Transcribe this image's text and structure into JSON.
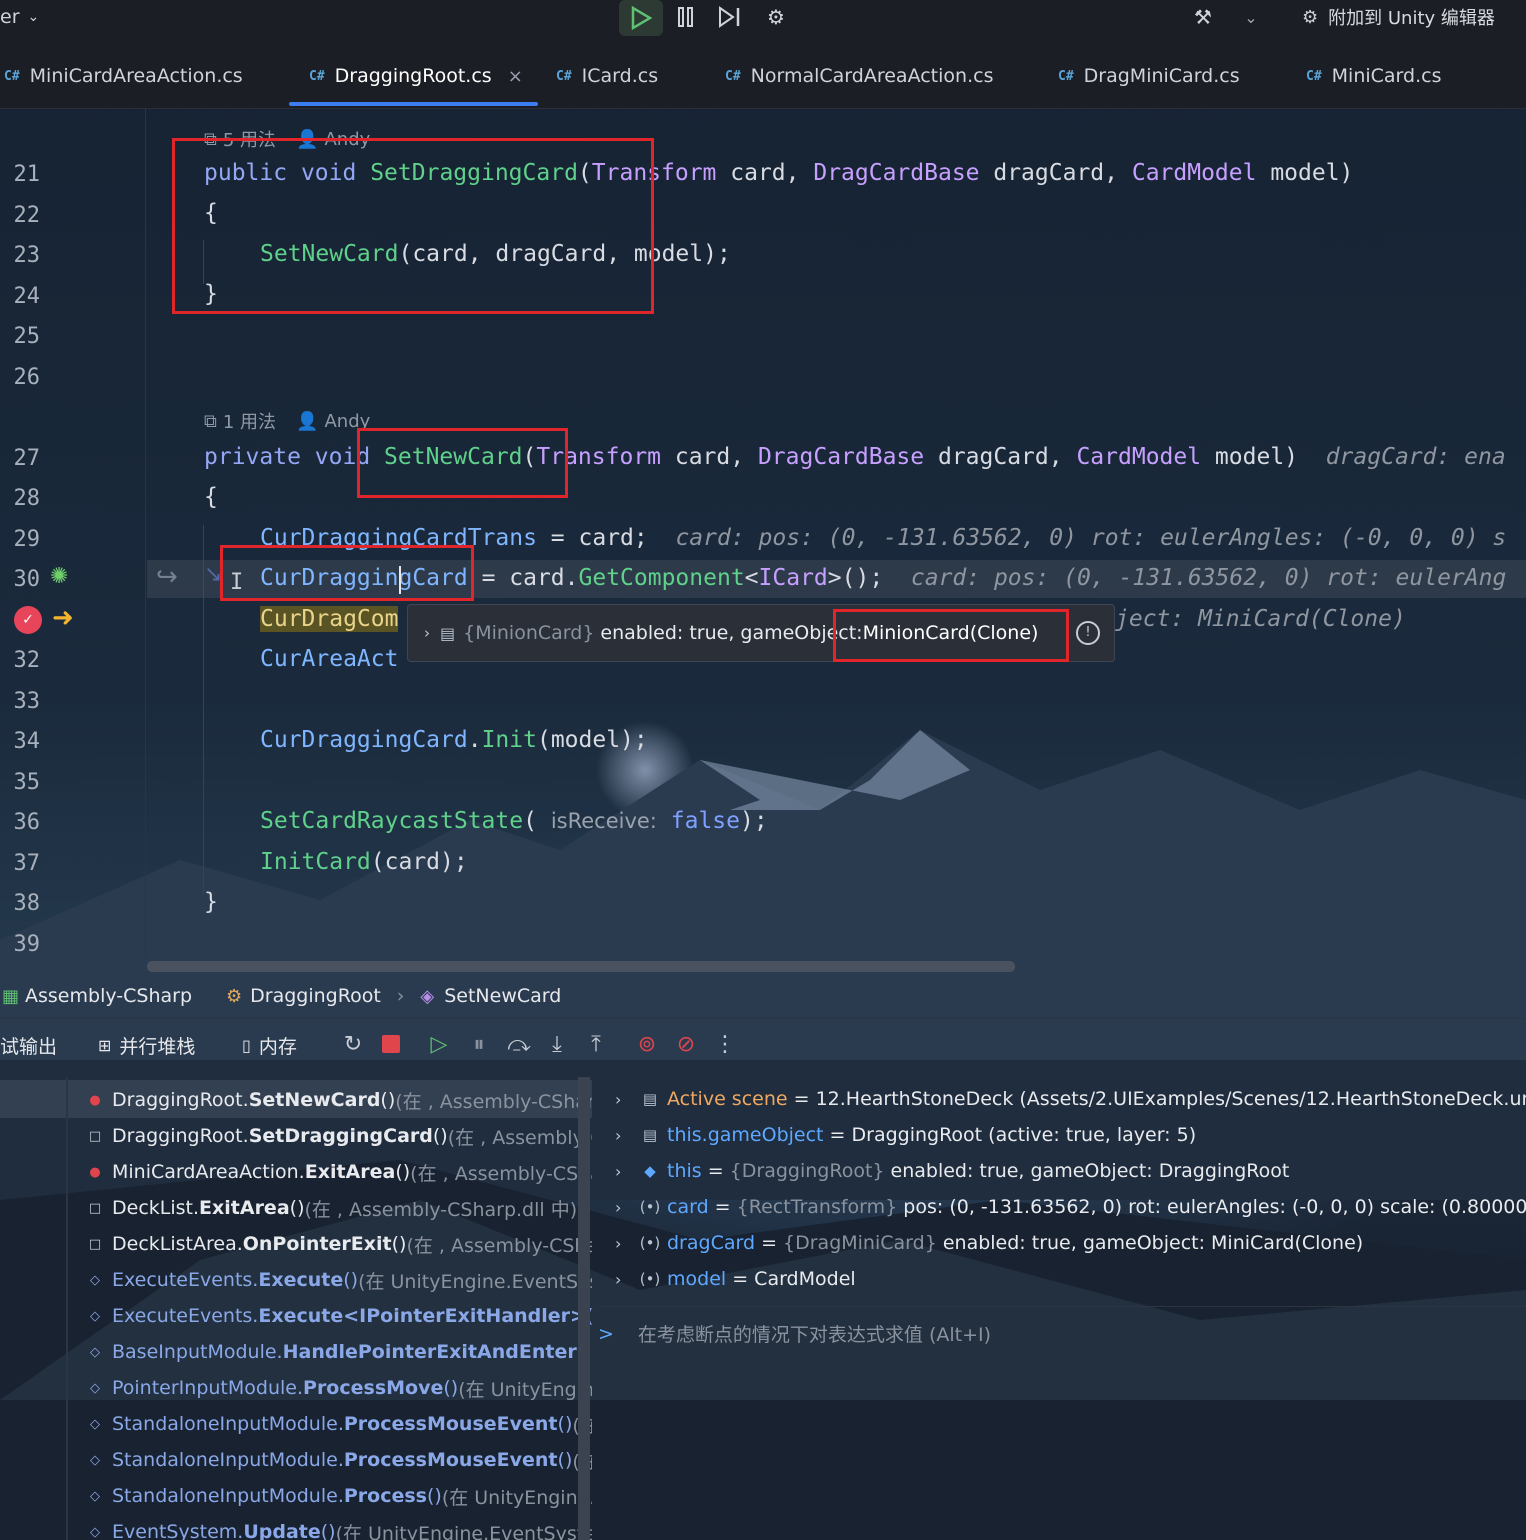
{
  "toolbar": {
    "left_label": "er",
    "attach_label": "附加到 Unity 编辑器"
  },
  "tabs": [
    {
      "label": "MiniCardAreaAction.cs"
    },
    {
      "label": "DraggingRoot.cs",
      "active": true
    },
    {
      "label": "ICard.cs"
    },
    {
      "label": "NormalCardAreaAction.cs"
    },
    {
      "label": "DragMiniCard.cs"
    },
    {
      "label": "MiniCard.cs"
    }
  ],
  "tab_prefix": "C#",
  "editor": {
    "line_numbers": [
      "21",
      "22",
      "23",
      "24",
      "25",
      "26",
      "27",
      "28",
      "29",
      "30",
      "31",
      "32",
      "33",
      "34",
      "35",
      "36",
      "37",
      "38",
      "39"
    ],
    "meta1": {
      "usages": "5 用法",
      "author": "Andy"
    },
    "meta2": {
      "usages": "1 用法",
      "author": "Andy"
    },
    "hint_param": "isReceive:",
    "inlay29": "card: pos: (0, -131.63562, 0) rot: eulerAngles: (-0, 0, 0) s",
    "inlay30": "card: pos: (0, -131.63562, 0) rot: eulerAng",
    "inlay27": "dragCard: ena",
    "inlay31": "ject: MiniCard(Clone)"
  },
  "tooltip": {
    "type": "{MinionCard}",
    "text": "enabled: true, gameObject: ",
    "value": "MinionCard(Clone)"
  },
  "breadcrumb": [
    "Assembly-CSharp",
    "DraggingRoot",
    "SetNewCard"
  ],
  "debug_tabs": {
    "output": "试输出",
    "parallel": "并行堆栈",
    "memory": "内存"
  },
  "frames": [
    {
      "marker": "dot",
      "cls": "DraggingRoot.",
      "method": "SetNewCard",
      "args": "()",
      "loc": " (在 , Assembly-CSharp"
    },
    {
      "marker": "square",
      "cls": "DraggingRoot.",
      "method": "SetDraggingCard",
      "args": "()",
      "loc": " (在 , Assembly-C"
    },
    {
      "marker": "dot",
      "cls": "MiniCardAreaAction.",
      "method": "ExitArea",
      "args": "()",
      "loc": " (在 , Assembly-CSha"
    },
    {
      "marker": "square",
      "cls": "DeckList.",
      "method": "ExitArea",
      "args": "()",
      "loc": " (在 , Assembly-CSharp.dll 中)"
    },
    {
      "marker": "square",
      "cls": "DeckListArea.",
      "method": "OnPointerExit",
      "args": "()",
      "loc": " (在 , Assembly-CShar"
    },
    {
      "marker": "diamond",
      "cls": "ExecuteEvents.",
      "method": "Execute",
      "args": "()",
      "loc": " (在 UnityEngine.EventSyst"
    },
    {
      "marker": "diamond",
      "cls": "ExecuteEvents.",
      "method": "Execute<IPointerExitHandler>",
      "args": "()",
      "loc": " (在"
    },
    {
      "marker": "diamond",
      "cls": "BaseInputModule.",
      "method": "HandlePointerExitAndEnter",
      "args": "()",
      "loc": " (在"
    },
    {
      "marker": "diamond",
      "cls": "PointerInputModule.",
      "method": "ProcessMove",
      "args": "()",
      "loc": " (在 UnityEngine"
    },
    {
      "marker": "diamond",
      "cls": "StandaloneInputModule.",
      "method": "ProcessMouseEvent",
      "args": "()",
      "loc": " (在 U"
    },
    {
      "marker": "diamond",
      "cls": "StandaloneInputModule.",
      "method": "ProcessMouseEvent",
      "args": "()",
      "loc": " (在 U"
    },
    {
      "marker": "diamond",
      "cls": "StandaloneInputModule.",
      "method": "Process",
      "args": "()",
      "loc": " (在 UnityEngine.E"
    },
    {
      "marker": "diamond",
      "cls": "EventSystem.",
      "method": "Update",
      "args": "()",
      "loc": " (在 UnityEngine.EventSystem"
    }
  ],
  "variables": [
    {
      "icon": "scene-icon",
      "name": "Active scene",
      "eq": " = ",
      "type": "",
      "value": "12.HearthStoneDeck (Assets/2.UIExamples/Scenes/12.HearthStoneDeck.unity)"
    },
    {
      "icon": "object-icon",
      "name": "this.gameObject",
      "eq": " = ",
      "type": "",
      "value": "DraggingRoot (active: true, layer: 5)"
    },
    {
      "icon": "this-icon",
      "name": "this",
      "eq": " = ",
      "type": "{DraggingRoot}",
      "value": " enabled: true, gameObject: DraggingRoot"
    },
    {
      "icon": "param-icon",
      "name": "card",
      "eq": " = ",
      "type": "{RectTransform}",
      "value": " pos: (0, -131.63562, 0) rot: eulerAngles: (-0, 0, 0) scale: (0.800000012"
    },
    {
      "icon": "param-icon",
      "name": "dragCard",
      "eq": " = ",
      "type": "{DragMiniCard}",
      "value": " enabled: true, gameObject: MiniCard(Clone)"
    },
    {
      "icon": "param-icon",
      "name": "model",
      "eq": " = ",
      "type": "",
      "value": "CardModel"
    }
  ],
  "eval": {
    "prompt": ">",
    "placeholder": "在考虑断点的情况下对表达式求值 (Alt+I)"
  },
  "colors": {
    "accent": "#3c7ef0",
    "highlight_box": "#e0252b",
    "keyword": "#94a7f5",
    "method": "#5fd18a",
    "type": "#c7a0ff"
  }
}
